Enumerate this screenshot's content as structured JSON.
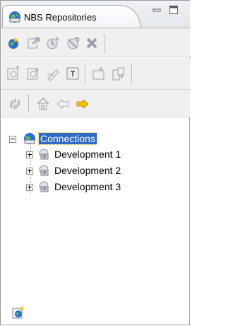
{
  "view": {
    "tab_title": "NBS Repositories",
    "tab_icon": "repository-globe-icon",
    "controls": [
      "minimize-icon",
      "maximize-icon"
    ]
  },
  "toolbar_row1": [
    "add-repository-icon",
    "connect-icon",
    "disconnect-icon",
    "remove-connection-icon",
    "delete-icon"
  ],
  "toolbar_row2": [
    "new-item-icon",
    "new-version-icon",
    "edit-icon",
    "properties-icon",
    "new-folder-icon",
    "export-icon"
  ],
  "toolbar_row3": [
    "sync-icon",
    "home-icon",
    "back-arrow-icon",
    "forward-arrow-icon"
  ],
  "tree": {
    "root": {
      "label": "Connections",
      "expanded": true,
      "selected": true
    },
    "children": [
      {
        "label": "Development 1",
        "expanded": false
      },
      {
        "label": "Development 2",
        "expanded": false
      },
      {
        "label": "Development 3",
        "expanded": false
      }
    ]
  },
  "footer_icon": "new-connection-icon",
  "colors": {
    "selection": "#316ac5",
    "accent_yellow": "#f5c400",
    "globe_blue": "#2a6fd0"
  }
}
